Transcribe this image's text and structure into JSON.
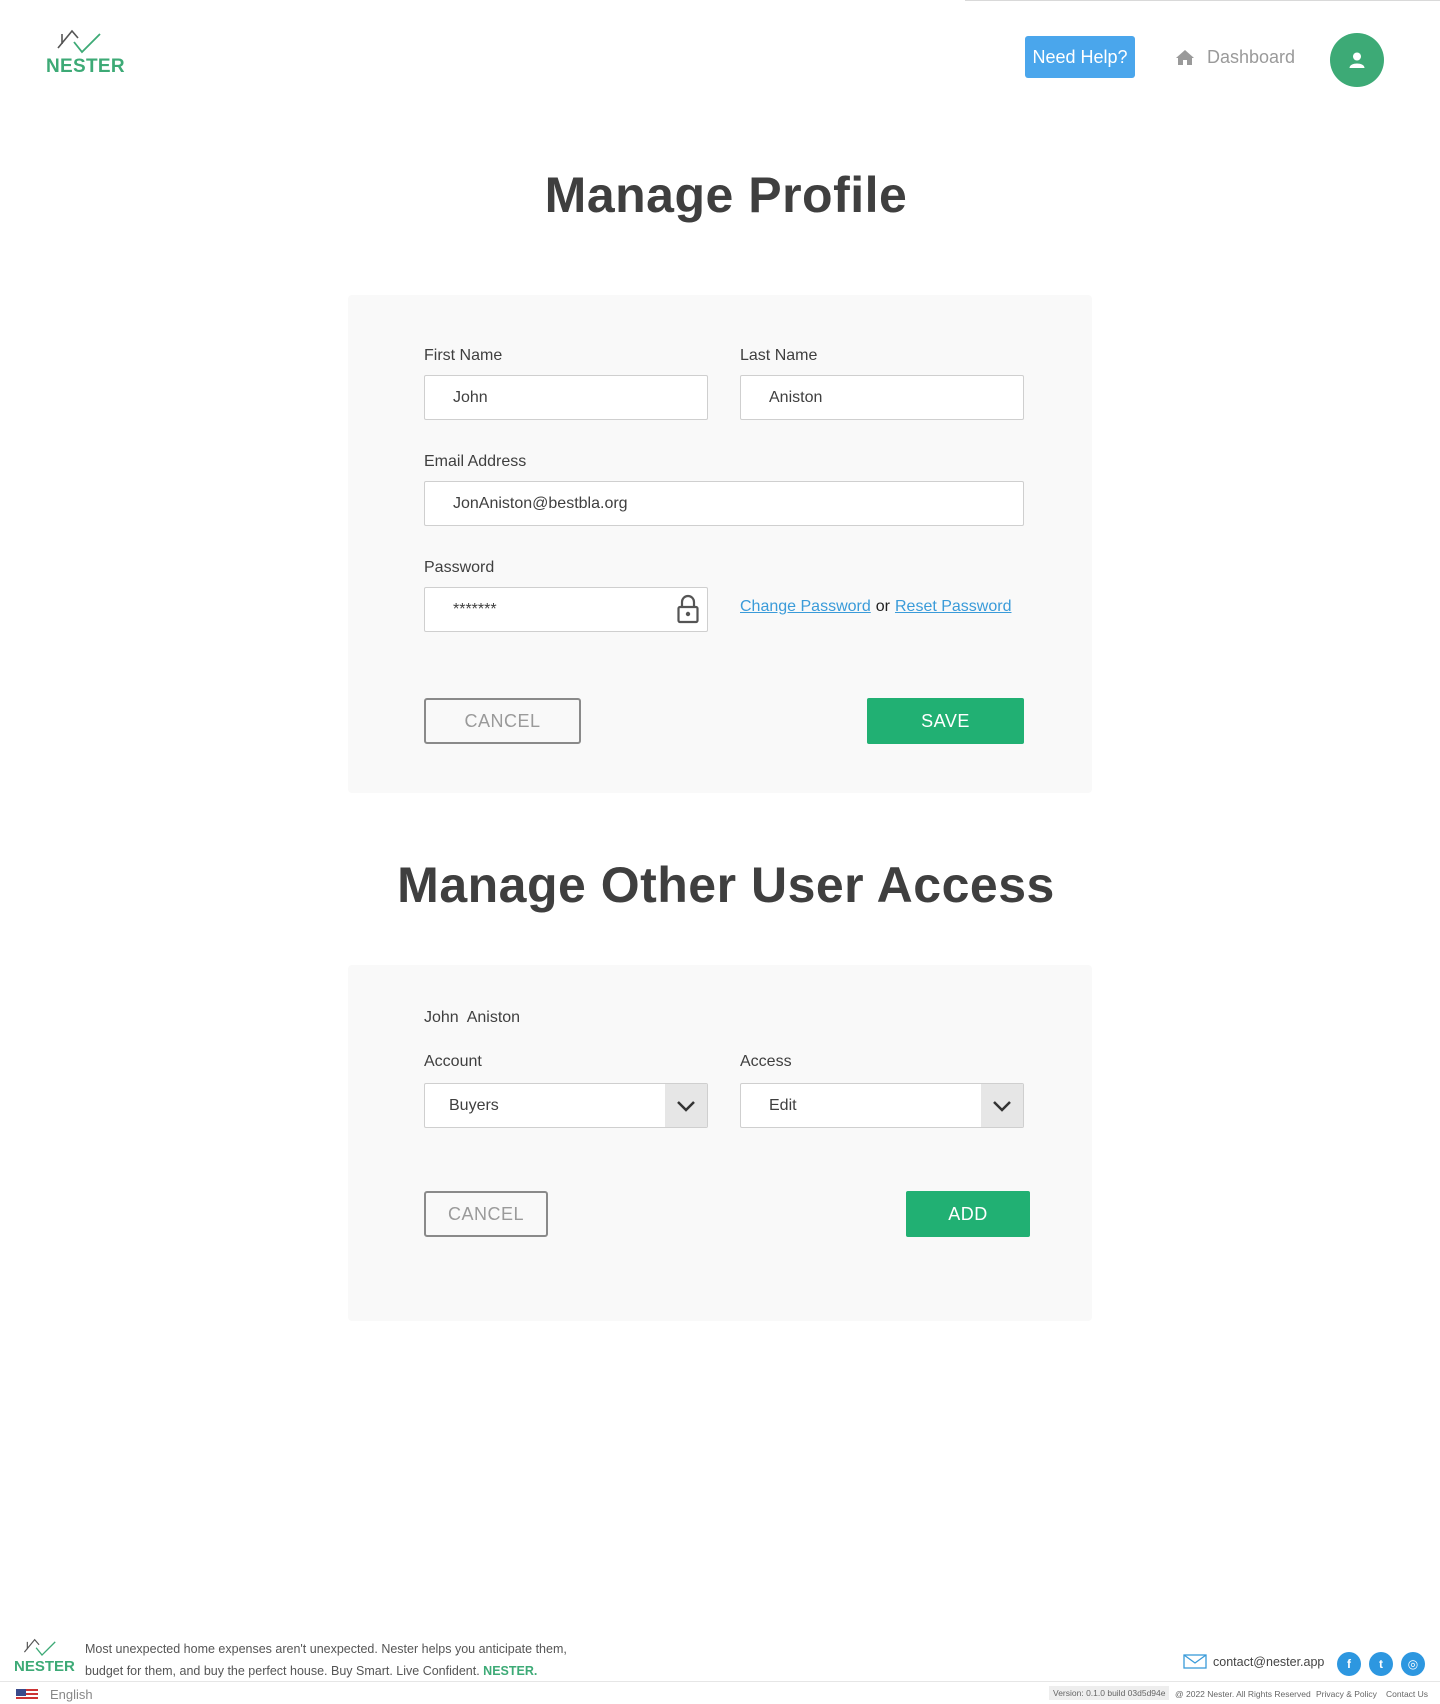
{
  "brand": {
    "name": "NESTER",
    "color": "#3daa76"
  },
  "header": {
    "help_label": "Need Help?",
    "dashboard_label": "Dashboard",
    "avatar_icon": "user-icon"
  },
  "profile": {
    "title": "Manage Profile",
    "first_name_label": "First Name",
    "first_name_value": "John",
    "last_name_label": "Last Name",
    "last_name_value": "Aniston",
    "email_label": "Email Address",
    "email_value": "JonAniston@bestbla.org",
    "password_label": "Password",
    "password_value": "*******",
    "change_password": "Change Password",
    "or_text": "or",
    "reset_password": "Reset Password",
    "cancel_label": "CANCEL",
    "save_label": "SAVE"
  },
  "access": {
    "title": "Manage Other User Access",
    "user_name": "John  Aniston",
    "account_label": "Account",
    "account_value": "Buyers",
    "access_label": "Access",
    "access_value": "Edit",
    "cancel_label": "CANCEL",
    "add_label": "ADD"
  },
  "footer": {
    "tagline_1": "Most unexpected home expenses aren't unexpected. Nester helps you anticipate them,",
    "tagline_2": "budget for them, and buy the perfect house. Buy Smart. Live Confident.",
    "tagline_brand": "NESTER.",
    "contact_email": "contact@nester.app",
    "social": [
      {
        "icon": "facebook-icon",
        "glyph": "f"
      },
      {
        "icon": "twitter-icon",
        "glyph": "t"
      },
      {
        "icon": "dribbble-icon",
        "glyph": "◎"
      }
    ],
    "language": "English",
    "version": "Version: 0.1.0 build 03d5d94e",
    "copyright": "@ 2022 Nester. All Rights Reserved",
    "privacy": "Privacy & Policy",
    "contact_us": "Contact Us"
  },
  "colors": {
    "green": "#21b073",
    "blue": "#4aa6ec",
    "link": "#3a9bd9",
    "card": "#f9f9f9"
  }
}
